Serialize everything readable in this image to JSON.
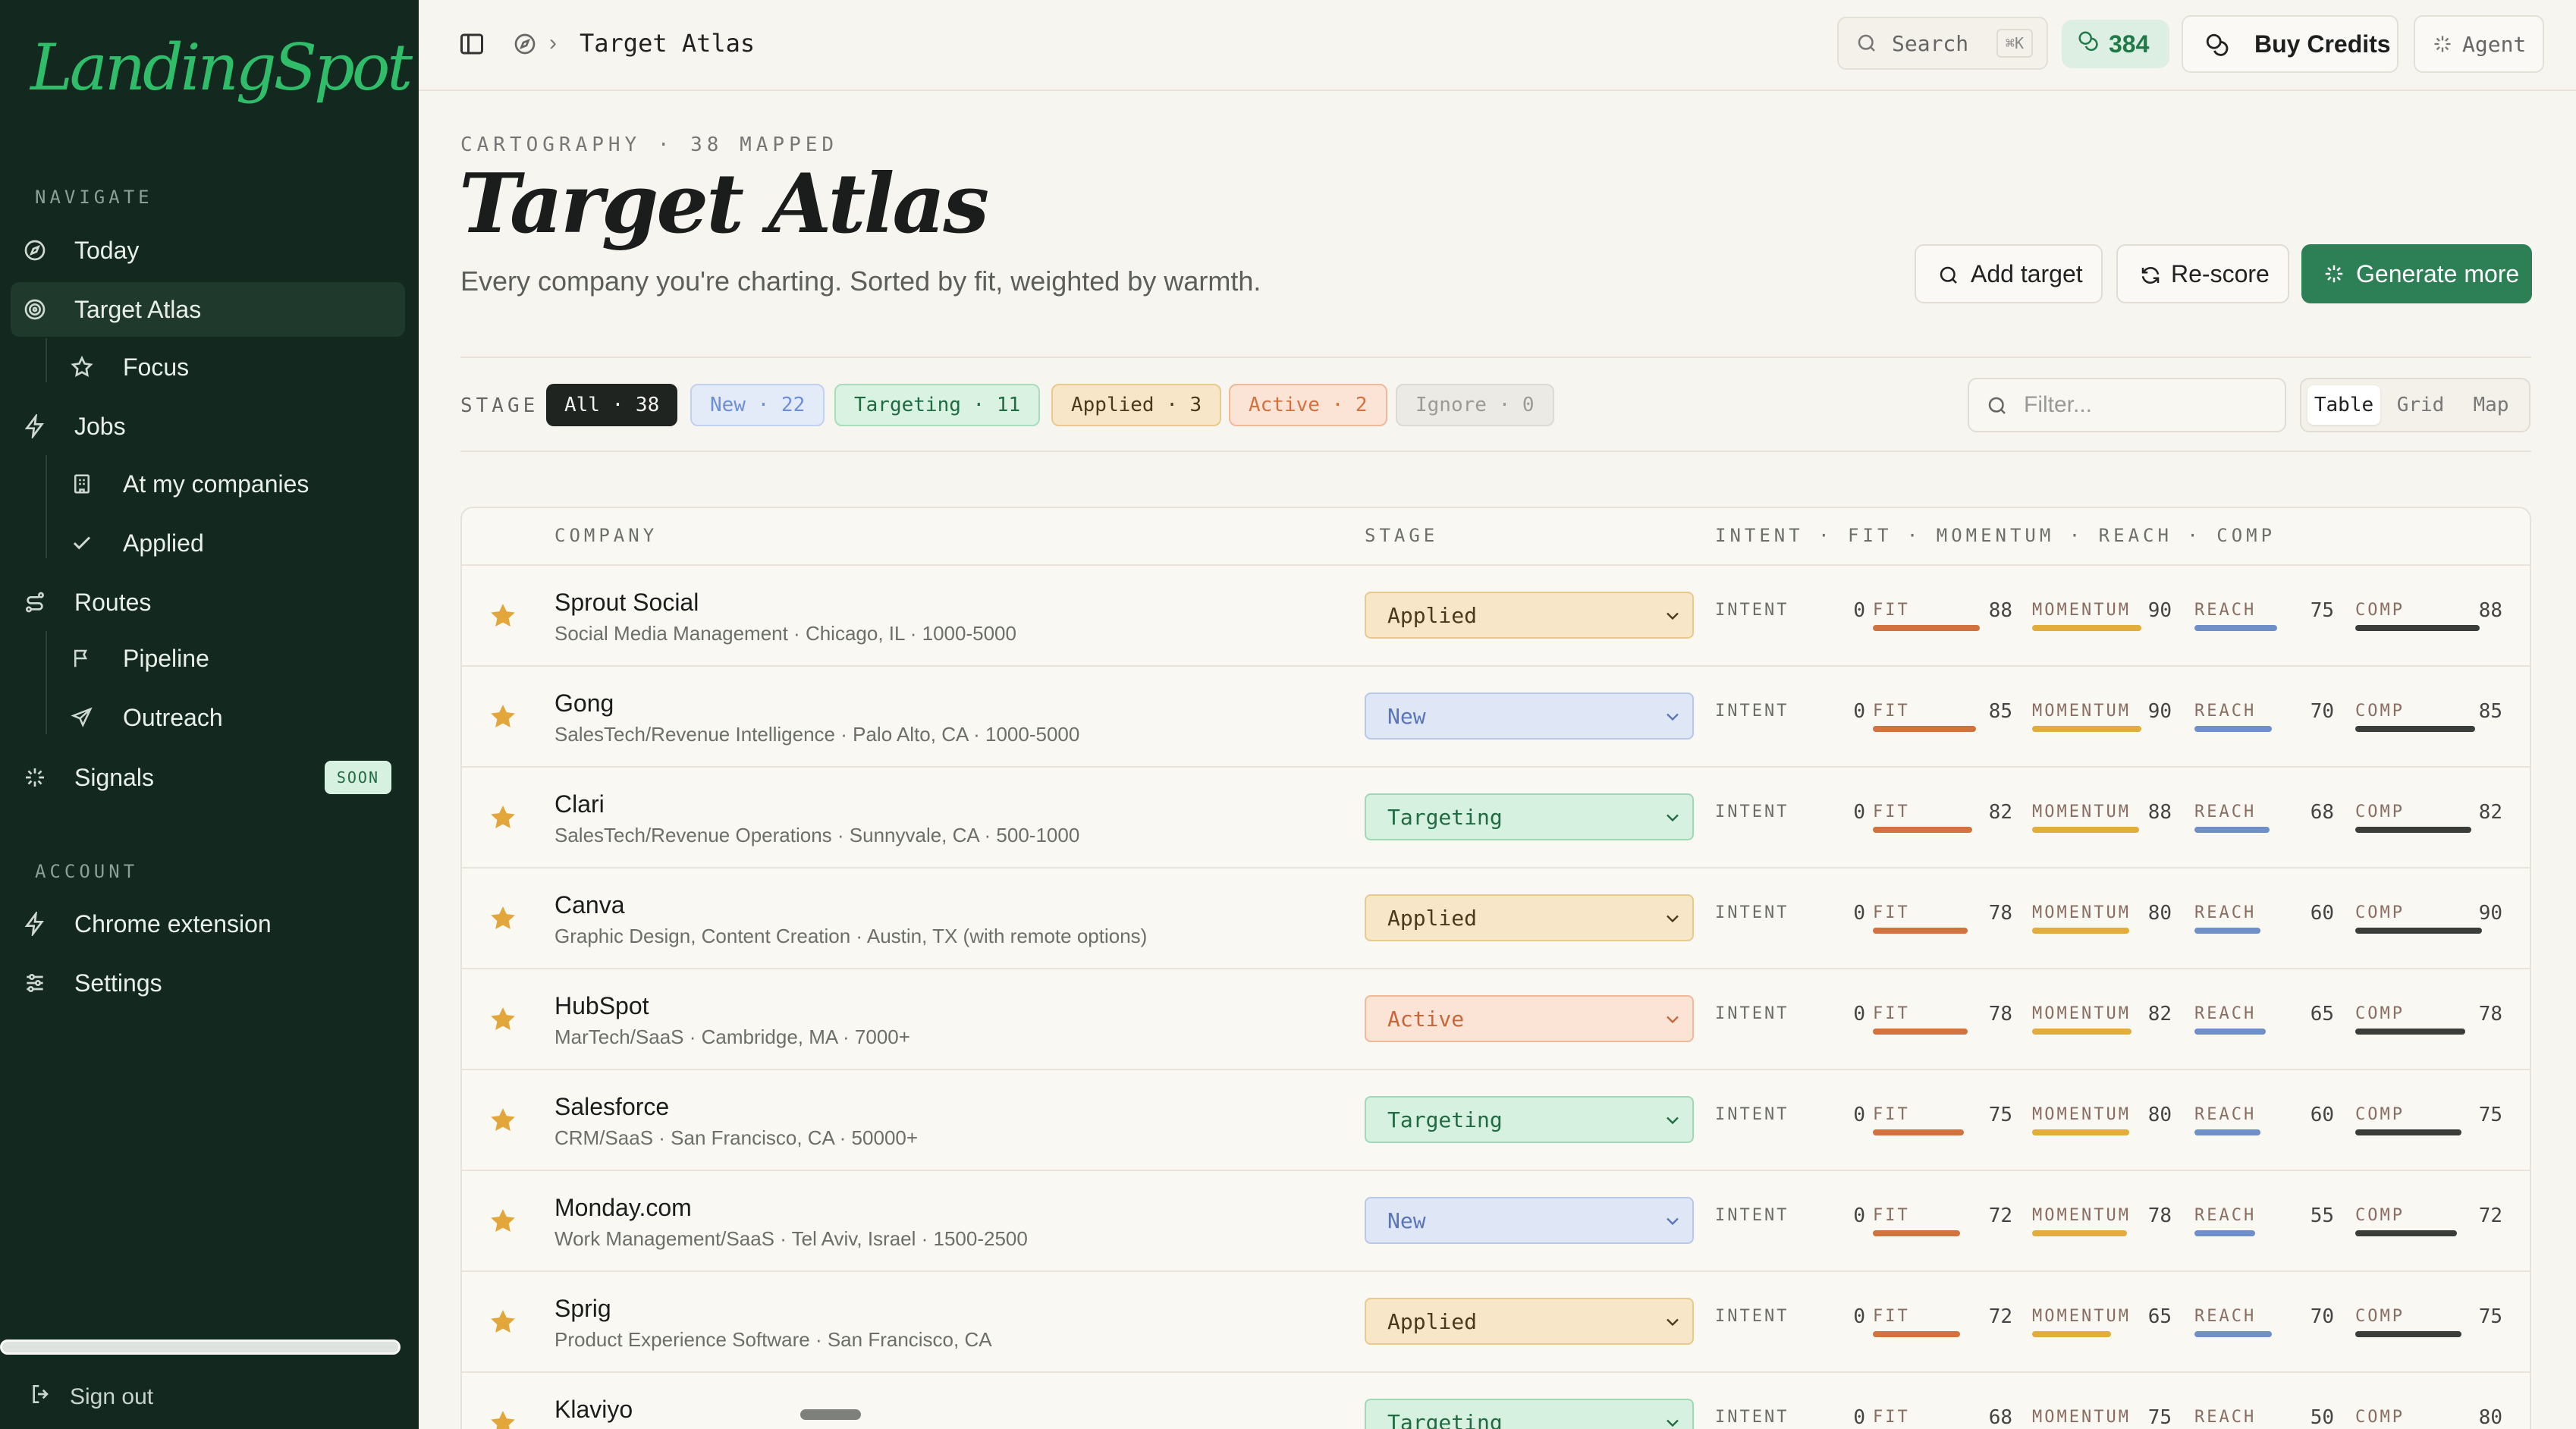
{
  "app": {
    "logo": "LandingSpot"
  },
  "sidebar": {
    "navigate_label": "NAVIGATE",
    "account_label": "ACCOUNT",
    "items": {
      "today": "Today",
      "target_atlas": "Target Atlas",
      "focus": "Focus",
      "jobs": "Jobs",
      "at_my_companies": "At my companies",
      "applied": "Applied",
      "routes": "Routes",
      "pipeline": "Pipeline",
      "outreach": "Outreach",
      "signals": "Signals",
      "signals_badge": "SOON",
      "chrome_extension": "Chrome extension",
      "settings": "Settings"
    },
    "sign_out": "Sign out"
  },
  "topbar": {
    "breadcrumb": "Target Atlas",
    "search_label": "Search",
    "search_shortcut": "⌘K",
    "credits": "384",
    "buy_credits": "Buy Credits",
    "agent": "Agent"
  },
  "header": {
    "eyebrow": "CARTOGRAPHY · 38 MAPPED",
    "title": "Target Atlas",
    "subtitle": "Every company you're charting. Sorted by fit, weighted by warmth.",
    "add_target": "Add target",
    "rescore": "Re-score",
    "generate_more": "Generate more"
  },
  "filters": {
    "stage_label": "STAGE",
    "chips": [
      {
        "label": "All · 38",
        "color": "#1f2420"
      },
      {
        "label": "New · 22",
        "color": "#6d8fd6"
      },
      {
        "label": "Targeting · 11",
        "color": "#2f9c63"
      },
      {
        "label": "Applied · 3",
        "color": "#9a6b1f"
      },
      {
        "label": "Active · 2",
        "color": "#d2733f"
      },
      {
        "label": "Ignore · 0",
        "color": "#9a9a96"
      }
    ],
    "filter_placeholder": "Filter...",
    "views": [
      "Table",
      "Grid",
      "Map"
    ],
    "active_view": "Table"
  },
  "table": {
    "headers": {
      "company": "COMPANY",
      "stage": "STAGE",
      "scores": "INTENT · FIT · MOMENTUM · REACH · COMP"
    },
    "metric_labels": {
      "intent": "INTENT",
      "fit": "FIT",
      "momentum": "MOMENTUM",
      "reach": "REACH",
      "comp": "COMP"
    },
    "colors": {
      "fit": "#d2733f",
      "momentum": "#e3ad3c",
      "reach": "#6f8fc9",
      "comp": "#3a3d3a",
      "star": "#e3a63a"
    },
    "rows": [
      {
        "name": "Sprout Social",
        "meta": "Social Media Management · Chicago, IL · 1000-5000",
        "stage": "Applied",
        "intent": "0",
        "fit": "88",
        "momentum": "90",
        "reach": "75",
        "comp": "88"
      },
      {
        "name": "Gong",
        "meta": "SalesTech/Revenue Intelligence · Palo Alto, CA · 1000-5000",
        "stage": "New",
        "intent": "0",
        "fit": "85",
        "momentum": "90",
        "reach": "70",
        "comp": "85"
      },
      {
        "name": "Clari",
        "meta": "SalesTech/Revenue Operations · Sunnyvale, CA · 500-1000",
        "stage": "Targeting",
        "intent": "0",
        "fit": "82",
        "momentum": "88",
        "reach": "68",
        "comp": "82"
      },
      {
        "name": "Canva",
        "meta": "Graphic Design, Content Creation · Austin, TX (with remote options)",
        "stage": "Applied",
        "intent": "0",
        "fit": "78",
        "momentum": "80",
        "reach": "60",
        "comp": "90"
      },
      {
        "name": "HubSpot",
        "meta": "MarTech/SaaS · Cambridge, MA · 7000+",
        "stage": "Active",
        "intent": "0",
        "fit": "78",
        "momentum": "82",
        "reach": "65",
        "comp": "78"
      },
      {
        "name": "Salesforce",
        "meta": "CRM/SaaS · San Francisco, CA · 50000+",
        "stage": "Targeting",
        "intent": "0",
        "fit": "75",
        "momentum": "80",
        "reach": "60",
        "comp": "75"
      },
      {
        "name": "Monday.com",
        "meta": "Work Management/SaaS · Tel Aviv, Israel · 1500-2500",
        "stage": "New",
        "intent": "0",
        "fit": "72",
        "momentum": "78",
        "reach": "55",
        "comp": "72"
      },
      {
        "name": "Sprig",
        "meta": "Product Experience Software · San Francisco, CA",
        "stage": "Applied",
        "intent": "0",
        "fit": "72",
        "momentum": "65",
        "reach": "70",
        "comp": "75"
      },
      {
        "name": "Klaviyo",
        "meta": "",
        "stage": "Targeting",
        "intent": "0",
        "fit": "68",
        "momentum": "75",
        "reach": "50",
        "comp": "80"
      }
    ]
  },
  "stage_styles": {
    "Applied": {
      "bg": "#f7e6c8",
      "border": "#e9c98c",
      "fg": "#4a3a1a"
    },
    "New": {
      "bg": "#dfe7f7",
      "border": "#b9c8ea",
      "fg": "#5a75b8"
    },
    "Targeting": {
      "bg": "#d7f1e0",
      "border": "#9fd8b5",
      "fg": "#1f6b42"
    },
    "Active": {
      "bg": "#fbe3d6",
      "border": "#efb99a",
      "fg": "#c8663a"
    }
  }
}
